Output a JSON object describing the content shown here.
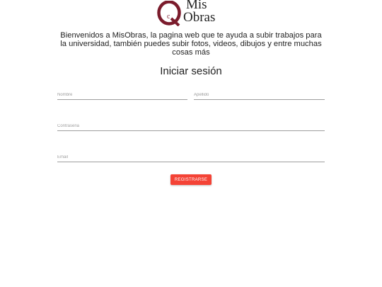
{
  "logo": {
    "line1": "Mis",
    "line2": "Obras",
    "mark_icon": "mis-obras-logo-icon",
    "brand_color": "#7b1c2c"
  },
  "intro": {
    "text": "Bienvenidos a MisObras, la pagina web que te ayuda a subir trabajos para la universidad, también puedes subir fotos, videos, dibujos y entre muchas cosas más"
  },
  "form": {
    "title": "Iniciar sesión",
    "nombre_placeholder": "Nombre",
    "apellido_placeholder": "Apellido",
    "password_placeholder": "Contraseña",
    "email_placeholder": "Email",
    "submit_label": "Registrarse",
    "submit_color": "#f44336"
  }
}
